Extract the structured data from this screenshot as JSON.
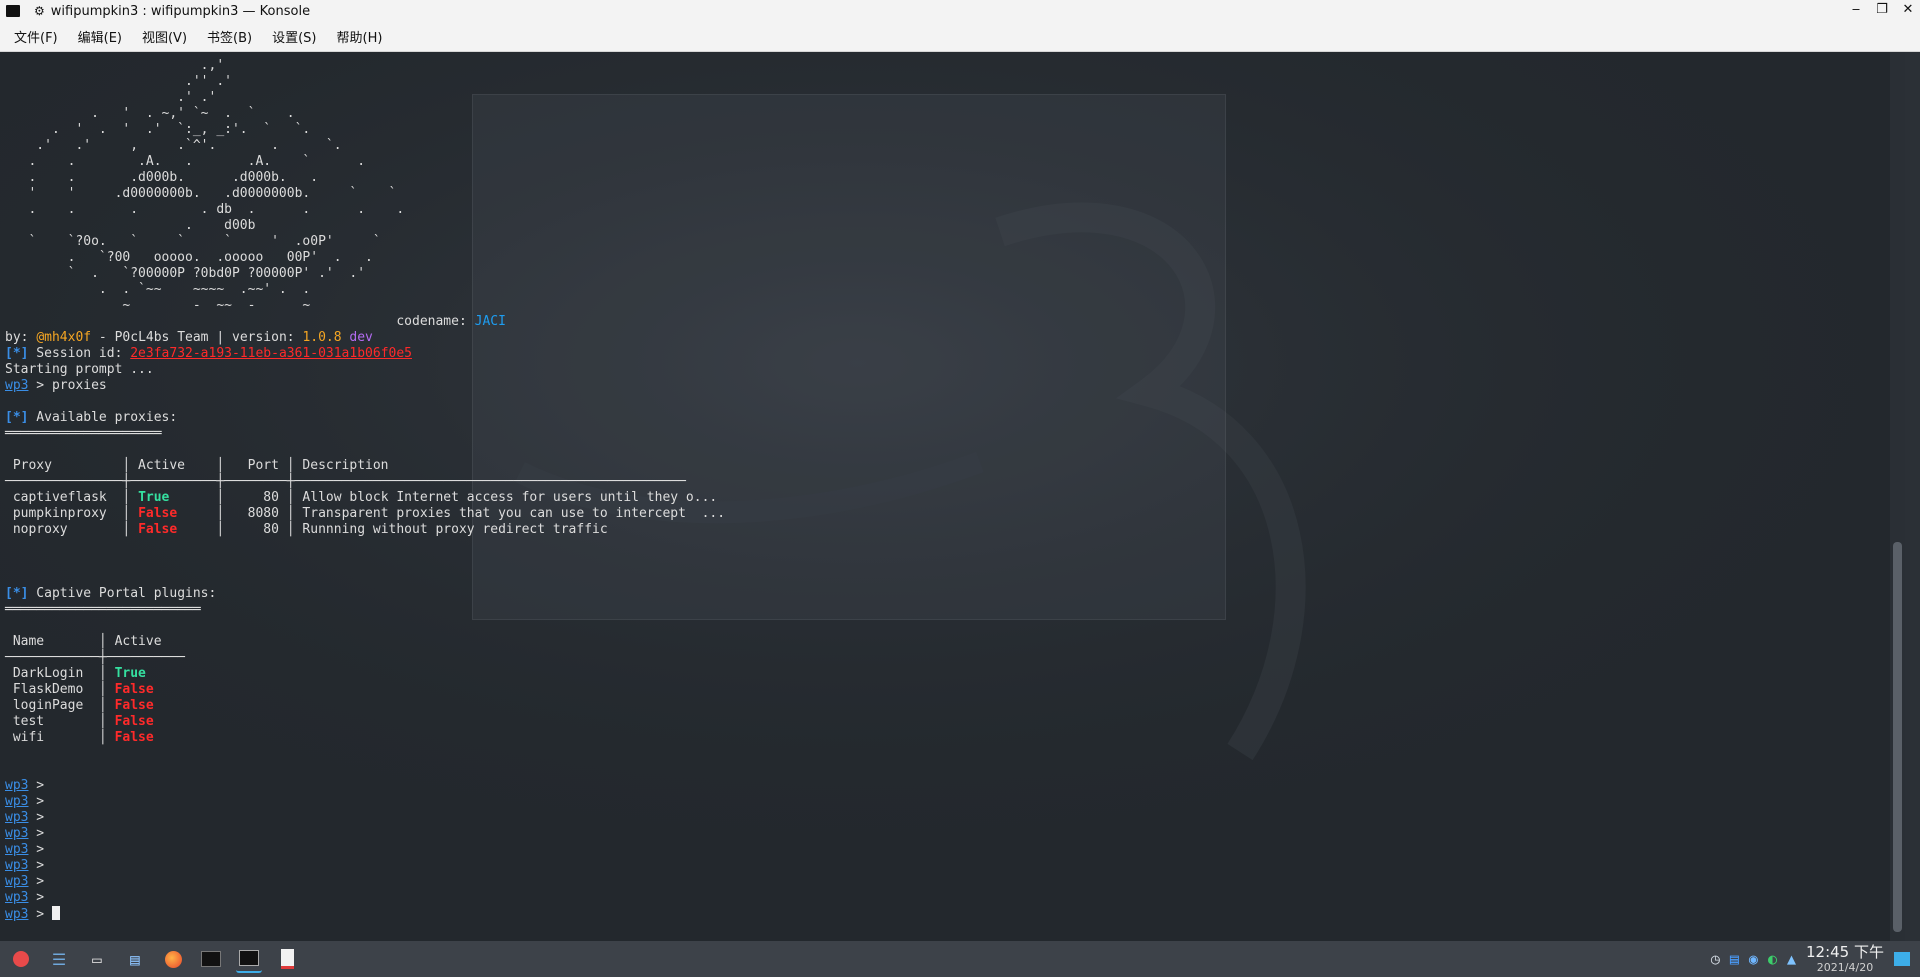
{
  "window": {
    "title": "wifipumpkin3 : wifipumpkin3 — Konsole",
    "controls": [
      "‒",
      "❐",
      "✕"
    ]
  },
  "menu": [
    "文件(F)",
    "编辑(E)",
    "视图(V)",
    "书签(B)",
    "设置(S)",
    "帮助(H)"
  ],
  "terminal": {
    "banner": "                         .,'\n                       .'' .'\n                      .' .'\n           .   '  . ~,' `~  .  `    .\n      .  '  .  '  .'  `:_, _:'.  `   `.\n    .'   .'     ,     .`^'.       .      `.\n   .    .        .A.   .       .A.    `      .\n   .    .       .d000b.      .d000b.   .\n   '    '     .d0000000b.   .d0000000b.     `    `\n   .    .       .        . db  .      .      .    .\n                       .    d00b\n   `    `?0o.   `     `     `     '  .o0P'     `\n        .   `?00   ooooo.  .ooooo   00P'  .   .\n        `  .   `?00000P ?0bd0P ?00000P' .'  .'\n            .  . `~~    ~~~~  .~~' .  .\n               ~        -  ~~  -      ~",
    "codename_label": "codename: ",
    "codename_value": "JACI",
    "by_label": "by: ",
    "author": "@mh4x0f",
    "team": " - P0cL4bs Team | version: ",
    "version": "1.0.8",
    "version_tag": " dev",
    "session_label": " Session id: ",
    "session_id": "2e3fa732-a193-11eb-a361-031a1b06f0e5",
    "starting": "Starting prompt ...",
    "prompt": "wp3",
    "command": " > proxies",
    "marker": "[*]",
    "proxies_title": " Available proxies:",
    "proxies_underline": "════════════════════",
    "proxies_table": {
      "header": " Proxy         │ Active    │   Port │ Description",
      "rule": "───────────────┼───────────┼────────┼──────────────────────────────────────────────────",
      "rows": [
        {
          "name": " captiveflask  │ ",
          "active": "True",
          "rest": "      │     80 │ Allow block Internet access for users until they o..."
        },
        {
          "name": " pumpkinproxy  │ ",
          "active": "False",
          "rest": "     │   8080 │ Transparent proxies that you can use to intercept  ..."
        },
        {
          "name": " noproxy       │ ",
          "active": "False",
          "rest": "     │     80 │ Runnning without proxy redirect traffic"
        }
      ]
    },
    "plugins_title": " Captive Portal plugins:",
    "plugins_underline": "═════════════════════════",
    "plugins_table": {
      "header": " Name       │ Active",
      "rule": "────────────┼──────────",
      "rows": [
        {
          "name": " DarkLogin  │ ",
          "active": "True"
        },
        {
          "name": " FlaskDemo  │ ",
          "active": "False"
        },
        {
          "name": " loginPage  │ ",
          "active": "False"
        },
        {
          "name": " test       │ ",
          "active": "False"
        },
        {
          "name": " wifi       │ ",
          "active": "False"
        }
      ]
    },
    "prompt_suffix": " > ",
    "empty_prompts": 9
  },
  "taskbar": {
    "apps": [
      "app-launcher",
      "settings",
      "file-manager",
      "files",
      "firefox",
      "terminal",
      "konsole",
      "document-viewer"
    ],
    "time": "12:45 下午",
    "date": "2021/4/20"
  },
  "colors": {
    "terminal_bg": "#23282d",
    "true": "#35e0a0",
    "false": "#ff2a2a",
    "prompt": "#3a8ee6",
    "orange": "#f5a623"
  }
}
